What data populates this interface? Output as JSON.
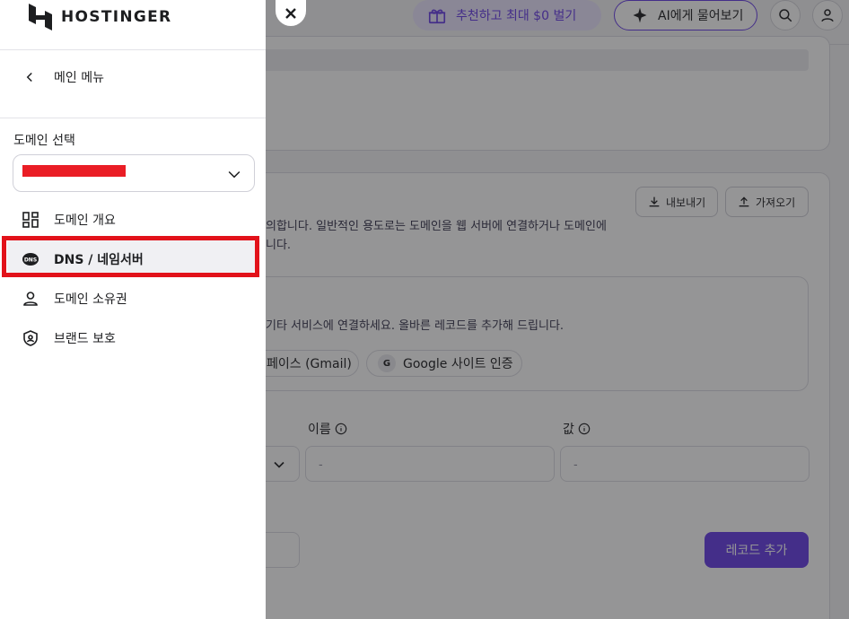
{
  "header": {
    "referral_label": "추천하고 최대 $0 벌기",
    "ai_label": "AI에게 물어보기"
  },
  "dns_section": {
    "export_label": "내보내기",
    "import_label": "가져오기",
    "description_lines": [
      "의합니다. 일반적인 용도로는 도메인을 웹 서버에 연결하거나 도메인에",
      "니다."
    ],
    "quick_setup_text": "기타 서비스에 연결하세요. 올바른 레코드를 추가해 드립니다.",
    "chips": [
      "페이스 (Gmail)",
      "Google 사이트 인증"
    ],
    "google_badge": "G",
    "form": {
      "name_label": "이름",
      "value_label": "값",
      "name_placeholder": "-",
      "value_placeholder": "-",
      "add_record_label": "레코드 추가"
    }
  },
  "drawer": {
    "brand": "HOSTINGER",
    "back_label": "메인 메뉴",
    "domain_select_label": "도메인 선택",
    "nav_items": [
      {
        "label": "도메인 개요",
        "icon": "grid-icon"
      },
      {
        "label": "DNS / 네임서버",
        "icon": "dns-icon",
        "active": true
      },
      {
        "label": "도메인 소유권",
        "icon": "person-icon"
      },
      {
        "label": "브랜드 보호",
        "icon": "shield-icon"
      }
    ],
    "dns_icon_text": "DNS"
  },
  "close_label": "✕",
  "colors": {
    "brand": "#673de6",
    "highlight": "#e2121a"
  }
}
